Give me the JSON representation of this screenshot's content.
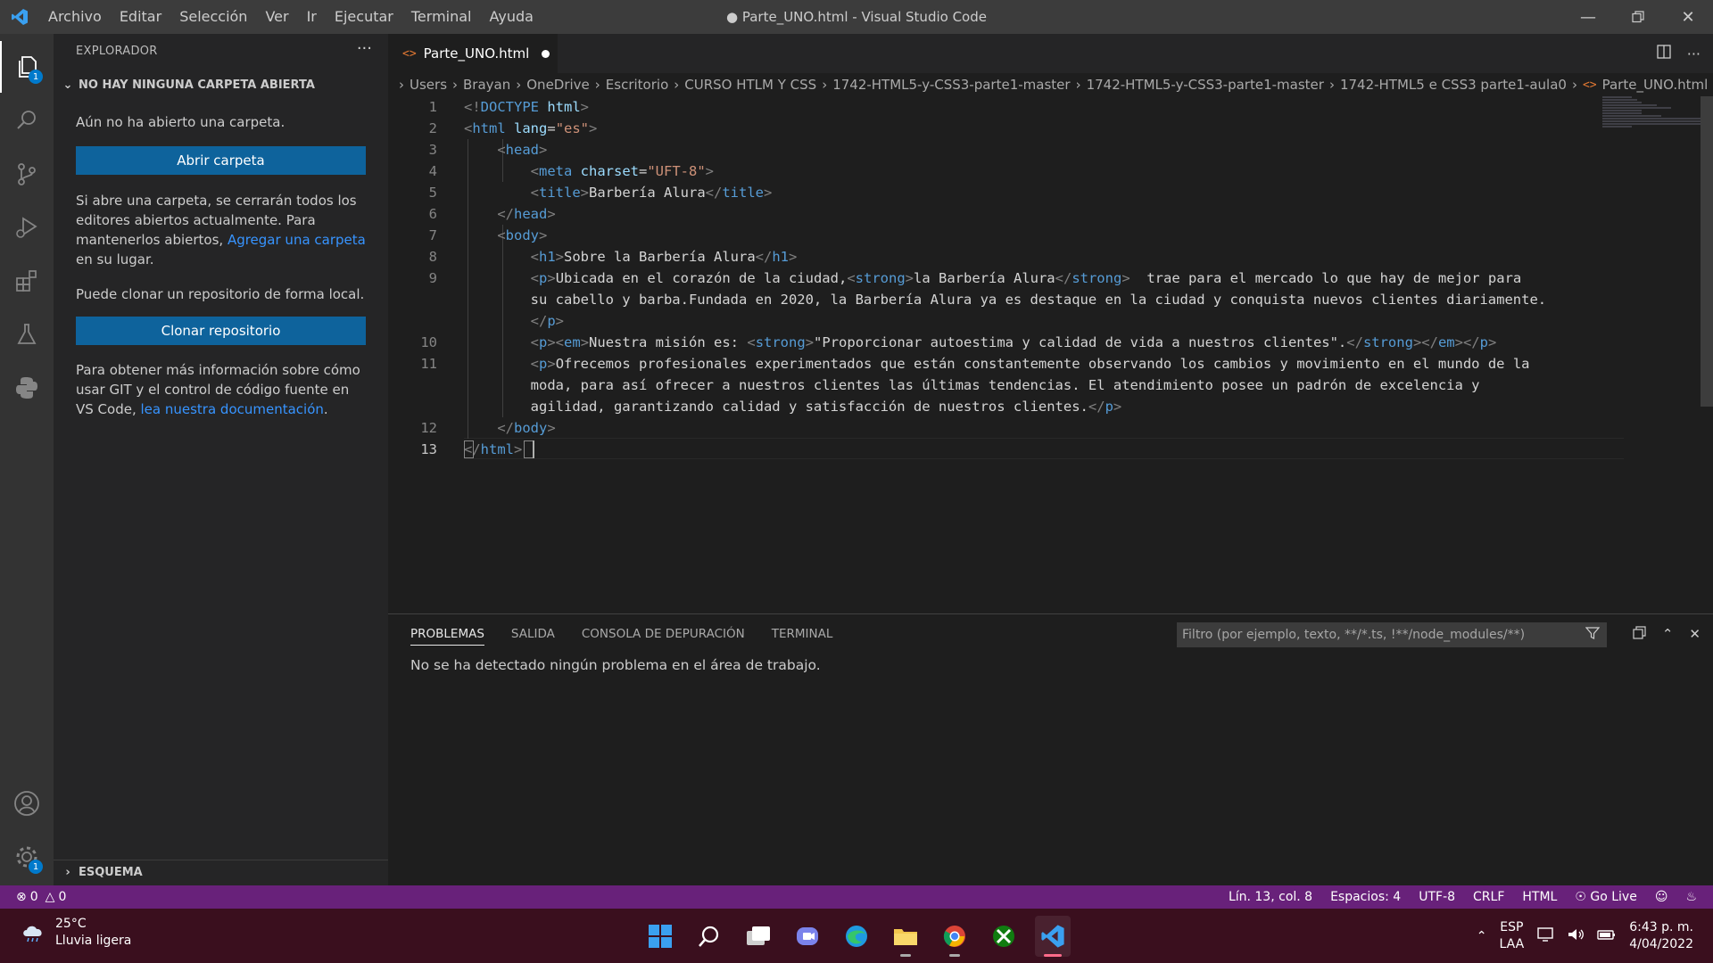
{
  "titlebar": {
    "menu": [
      "Archivo",
      "Editar",
      "Selección",
      "Ver",
      "Ir",
      "Ejecutar",
      "Terminal",
      "Ayuda"
    ],
    "window_title": "● Parte_UNO.html - Visual Studio Code"
  },
  "activity_bar": {
    "items": [
      "explorer-icon",
      "search-icon",
      "source-control-icon",
      "run-debug-icon",
      "extensions-icon",
      "testing-icon",
      "python-icon"
    ],
    "explorer_badge": "1",
    "settings_badge": "1"
  },
  "sidebar": {
    "title": "EXPLORADOR",
    "more": "···",
    "section_title": "NO HAY NINGUNA CARPETA ABIERTA",
    "no_folder_text": "Aún no ha abierto una carpeta.",
    "open_folder_button": "Abrir carpeta",
    "close_editors_text": "Si abre una carpeta, se cerrarán todos los editores abiertos actualmente. Para mantenerlos abiertos, ",
    "add_folder_link": "Agregar una carpeta",
    "close_editors_tail": " en su lugar.",
    "clone_text": "Puede clonar un repositorio de forma local.",
    "clone_button": "Clonar repositorio",
    "git_info_text": "Para obtener más información sobre cómo usar GIT y el control de código fuente en VS Code, ",
    "docs_link": "lea nuestra documentación",
    "git_info_tail": ".",
    "outline_title": "ESQUEMA"
  },
  "editor": {
    "tab_label": "Parte_UNO.html",
    "breadcrumb": [
      "Users",
      "Brayan",
      "OneDrive",
      "Escritorio",
      "CURSO HTLM Y CSS",
      "1742-HTML5-y-CSS3-parte1-master",
      "1742-HTML5-y-CSS3-parte1-master",
      "1742-HTML5 e CSS3 parte1-aula0",
      "Parte_UNO.html"
    ],
    "line_numbers": [
      "1",
      "2",
      "3",
      "4",
      "5",
      "6",
      "7",
      "8",
      "9",
      "10",
      "11",
      "12",
      "13"
    ],
    "cursor_line": "13"
  },
  "panel": {
    "tabs": [
      "PROBLEMAS",
      "SALIDA",
      "CONSOLA DE DEPURACIÓN",
      "TERMINAL"
    ],
    "filter_placeholder": "Filtro (por ejemplo, texto, **/*.ts, !**/node_modules/**)",
    "message": "No se ha detectado ningún problema en el área de trabajo."
  },
  "statusbar": {
    "errors": "0",
    "warnings": "0",
    "position": "Lín. 13, col. 8",
    "spaces": "Espacios: 4",
    "encoding": "UTF-8",
    "eol": "CRLF",
    "language": "HTML",
    "golive": "Go Live"
  },
  "taskbar": {
    "temperature": "25°C",
    "weather": "Lluvia ligera",
    "lang1": "ESP",
    "lang2": "LAA",
    "time": "6:43 p. m.",
    "date": "4/04/2022"
  },
  "colors": {
    "statusbar": "#68217a",
    "accent_button": "#0e639c",
    "taskbar": "#3a0f1e"
  }
}
